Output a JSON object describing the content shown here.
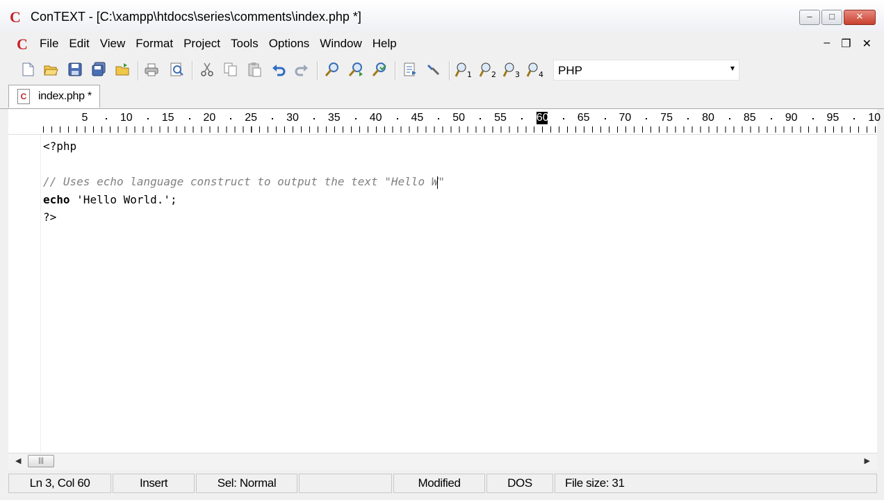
{
  "window": {
    "app_logo": "C",
    "title": "ConTEXT - [C:\\xampp\\htdocs\\series\\comments\\index.php *]",
    "controls": {
      "minimize": "–",
      "maximize": "□",
      "close": "✕"
    }
  },
  "menubar": {
    "logo": "C",
    "items": [
      "File",
      "Edit",
      "View",
      "Format",
      "Project",
      "Tools",
      "Options",
      "Window",
      "Help"
    ],
    "mdi_controls": {
      "minimize": "–",
      "restore": "❐",
      "close": "✕"
    }
  },
  "toolbar": {
    "language": "PHP",
    "language_arrow": "▾",
    "icons": [
      "new-file-icon",
      "open-file-icon",
      "save-icon",
      "save-all-icon",
      "open-folder-icon",
      "print-icon",
      "print-preview-icon",
      "cut-icon",
      "copy-icon",
      "paste-icon",
      "undo-icon",
      "redo-icon",
      "find-icon",
      "find-next-icon",
      "replace-icon",
      "export-icon",
      "tool-icon",
      "user-tool-1-icon",
      "user-tool-2-icon",
      "user-tool-3-icon",
      "user-tool-4-icon"
    ]
  },
  "tabs": [
    {
      "label": "index.php *",
      "icon": "C"
    }
  ],
  "ruler": {
    "numbers": [
      "5",
      "10",
      "15",
      "20",
      "25",
      "30",
      "35",
      "40",
      "45",
      "50",
      "55",
      "60",
      "65",
      "70",
      "75",
      "80",
      "85",
      "90",
      "95",
      "10"
    ],
    "cursor_column": "60"
  },
  "editor": {
    "lines": [
      {
        "parts": [
          {
            "cls": "plain",
            "text": "<?php"
          }
        ]
      },
      {
        "parts": [
          {
            "cls": "plain",
            "text": ""
          }
        ]
      },
      {
        "parts": [
          {
            "cls": "comment",
            "text": "// Uses echo language construct to output the text \"Hello W"
          },
          {
            "cls": "caret",
            "text": ""
          },
          {
            "cls": "comment",
            "text": "\""
          }
        ]
      },
      {
        "parts": [
          {
            "cls": "kw",
            "text": "echo"
          },
          {
            "cls": "plain",
            "text": " "
          },
          {
            "cls": "str",
            "text": "'Hello World.'"
          },
          {
            "cls": "plain",
            "text": ";"
          }
        ]
      },
      {
        "parts": [
          {
            "cls": "plain",
            "text": "?>"
          }
        ]
      }
    ]
  },
  "scrollbar": {
    "left_arrow": "◀",
    "right_arrow": "▶",
    "thumb_grip": "|||"
  },
  "statusbar": {
    "position": "Ln 3, Col 60",
    "mode": "Insert",
    "selection": "Sel: Normal",
    "blank": "",
    "modified": "Modified",
    "line_ending": "DOS",
    "file_size": "File size: 31"
  },
  "colors": {
    "logo_red": "#c6242a",
    "comment_gray": "#808080",
    "close_button": "#c8402e"
  }
}
